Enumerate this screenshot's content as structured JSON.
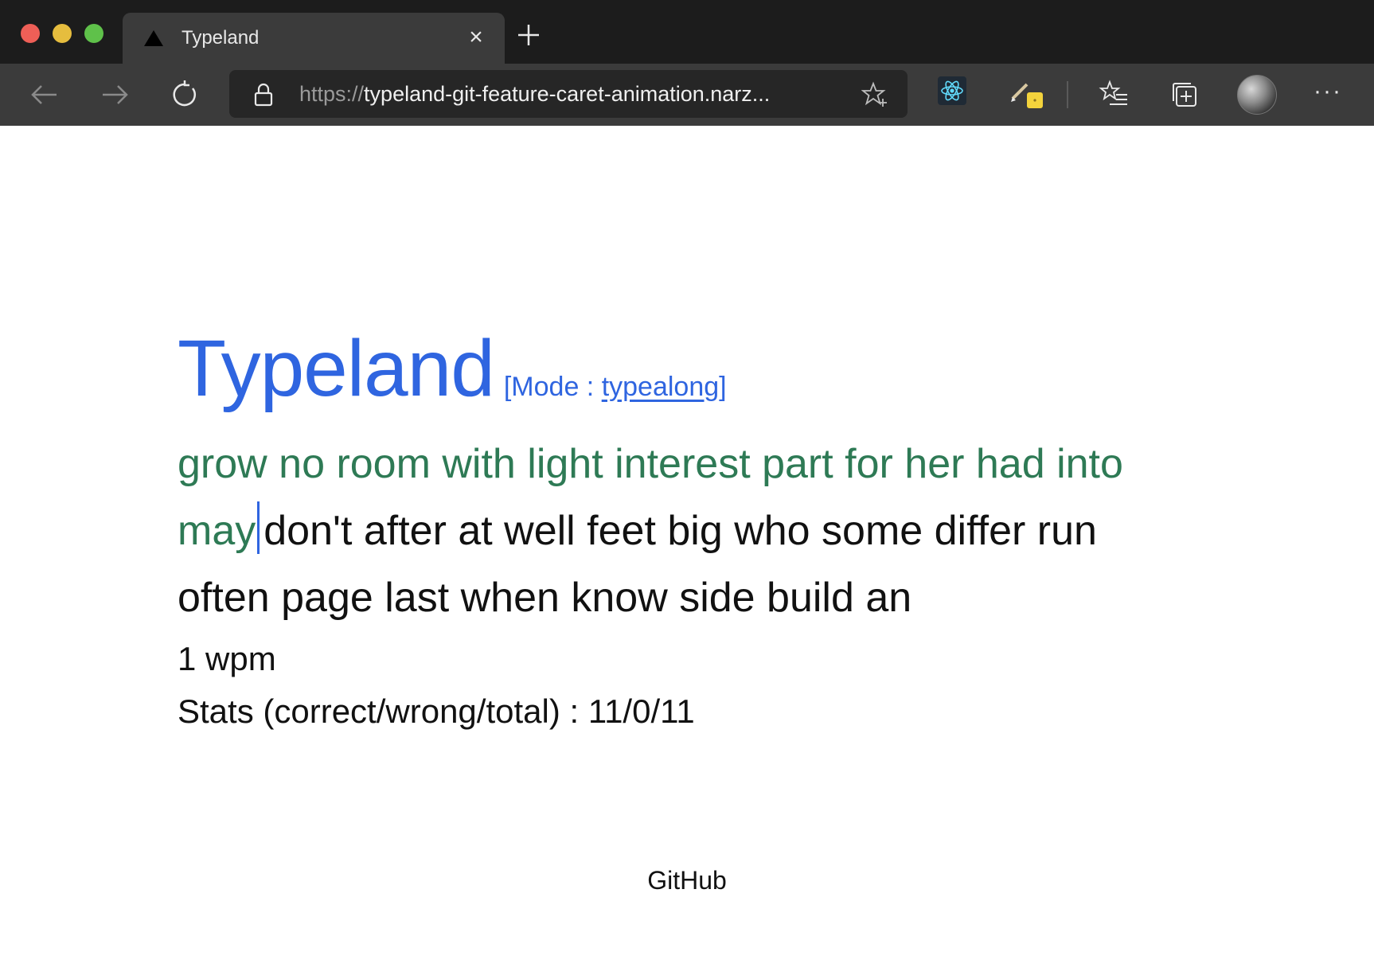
{
  "browser": {
    "tab": {
      "title": "Typeland",
      "close_label": "×"
    },
    "toolbar": {
      "url_scheme": "https://",
      "url_rest": "typeland-git-feature-caret-animation.narz...",
      "more_label": "···"
    }
  },
  "page": {
    "title": "Typeland",
    "mode_prefix": "[Mode : ",
    "mode_value": "typealong",
    "mode_suffix": "]",
    "typed_text": "grow no room with light interest part for her had into may",
    "remaining_text": "don't after at well feet big who some differ run often page last when know side build an",
    "wpm": "1 wpm",
    "stats": "Stats (correct/wrong/total) : 11/0/11",
    "footer_link": "GitHub"
  },
  "colors": {
    "accent": "#2f65e0",
    "typed": "#2e7a55",
    "text": "#111111"
  }
}
